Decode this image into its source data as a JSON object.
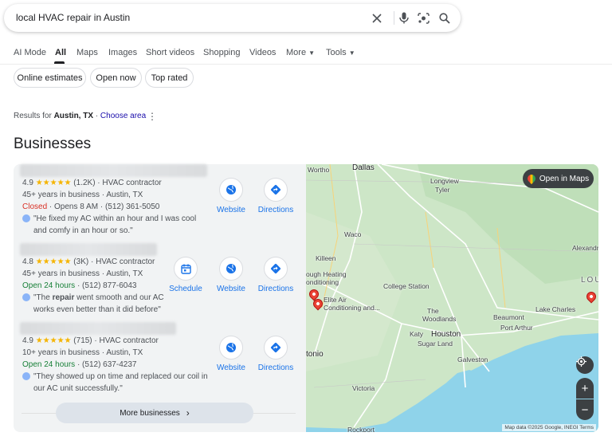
{
  "search": {
    "query": "local HVAC repair in Austin"
  },
  "tabs": [
    {
      "label": "AI Mode"
    },
    {
      "label": "All"
    },
    {
      "label": "Maps"
    },
    {
      "label": "Images"
    },
    {
      "label": "Short videos"
    },
    {
      "label": "Shopping"
    },
    {
      "label": "Videos"
    },
    {
      "label": "More"
    },
    {
      "label": "Tools"
    }
  ],
  "chips": [
    {
      "label": "Online estimates"
    },
    {
      "label": "Open now"
    },
    {
      "label": "Top rated"
    }
  ],
  "results_for": {
    "prefix": "Results for",
    "location": "Austin, TX",
    "separator": " · ",
    "choose": "Choose area"
  },
  "section_title": "Businesses",
  "businesses": [
    {
      "rating": "4.9",
      "stars": "★★★★★",
      "reviews": "(1.2K)",
      "category": "HVAC contractor",
      "line2": "45+ years in business · Austin, TX",
      "status": "Closed",
      "hours": " · Opens 8 AM · (512) 361-5050",
      "review": "\"He fixed my AC within an hour and I was cool and comfy in an hour or so.\""
    },
    {
      "rating": "4.8",
      "stars": "★★★★★",
      "reviews": "(3K)",
      "category": "HVAC contractor",
      "line2": "45+ years in business · Austin, TX",
      "status": "Open 24 hours",
      "hours": " · (512) 877-6043",
      "review_pre": "\"The ",
      "review_bold": "repair",
      "review_post": " went smooth and our AC works even better than it did before\""
    },
    {
      "rating": "4.9",
      "stars": "★★★★★",
      "reviews": "(715)",
      "category": "HVAC contractor",
      "line2": "10+ years in business · Austin, TX",
      "status": "Open 24 hours",
      "hours": " · (512) 637-4237",
      "review": "\"They showed up on time and replaced our coil in our AC unit successfully.\""
    }
  ],
  "actions": {
    "website": "Website",
    "directions": "Directions",
    "schedule": "Schedule"
  },
  "more_businesses": "More businesses",
  "map": {
    "open_in_maps": "Open in Maps",
    "attribution": "Map data ©2025 Google, INEGI    Terms",
    "labels": {
      "fort_worth": "Wortho",
      "dallas": "Dallas",
      "longview": "Longview",
      "tyler": "Tyler",
      "waco": "Waco",
      "killeen": "Killeen",
      "college_station": "College Station",
      "alexandria": "Alexandri",
      "biz_label_1": "ough Heating",
      "biz_label_1b": "onditioning",
      "elite_air": "Elite Air",
      "elite_air_2": "Conditioning and...",
      "the_woodlands": "The",
      "the_woodlands_2": "Woodlands",
      "lake_charles": "Lake Charles",
      "beaumont": "Beaumont",
      "port_arthur": "Port Arthur",
      "katy": "Katy",
      "houston": "Houston",
      "sugar_land": "Sugar Land",
      "antonio": "tonio",
      "galveston": "Galveston",
      "victoria": "Victoria",
      "rockport": "Rockport",
      "louisiana": "LOU"
    }
  },
  "colors": {
    "link": "#1a73e8",
    "closed": "#d93025",
    "open": "#188038",
    "stars": "#f5b400",
    "water": "#8fd3ea",
    "land": "#c8e2c4"
  }
}
